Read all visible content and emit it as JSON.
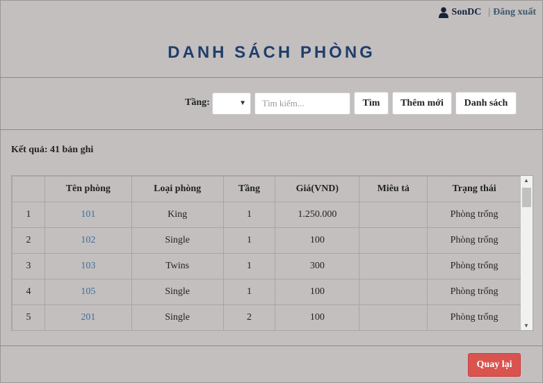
{
  "user": {
    "name": "SonDC",
    "separator": "|",
    "logout_label": "Đăng xuất"
  },
  "page": {
    "title": "DANH SÁCH PHÒNG"
  },
  "filters": {
    "floor_label": "Tầng:",
    "floor_value": "",
    "search_placeholder": "Tìm kiếm...",
    "search_button": "Tìm",
    "add_button": "Thêm mới",
    "list_button": "Danh sách"
  },
  "result_text": "Kết quả: 41 bản ghi",
  "table": {
    "headers": [
      "",
      "Tên phòng",
      "Loại phòng",
      "Tầng",
      "Giá(VND)",
      "Miêu tả",
      "Trạng thái"
    ],
    "rows": [
      [
        "1",
        "101",
        "King",
        "1",
        "1.250.000",
        "",
        "Phòng trống"
      ],
      [
        "2",
        "102",
        "Single",
        "1",
        "100",
        "",
        "Phòng trống"
      ],
      [
        "3",
        "103",
        "Twins",
        "1",
        "300",
        "",
        "Phòng trống"
      ],
      [
        "4",
        "105",
        "Single",
        "1",
        "100",
        "",
        "Phòng trống"
      ],
      [
        "5",
        "201",
        "Single",
        "2",
        "100",
        "",
        "Phòng trống"
      ]
    ]
  },
  "footer": {
    "back_button": "Quay lại"
  },
  "colors": {
    "background": "#c3bfbf",
    "title": "#1f3e6b",
    "link": "#3e6d9c",
    "back_button": "#d9534f"
  },
  "icons": {
    "user": "user-icon",
    "dropdown": "chevron-down-icon"
  }
}
